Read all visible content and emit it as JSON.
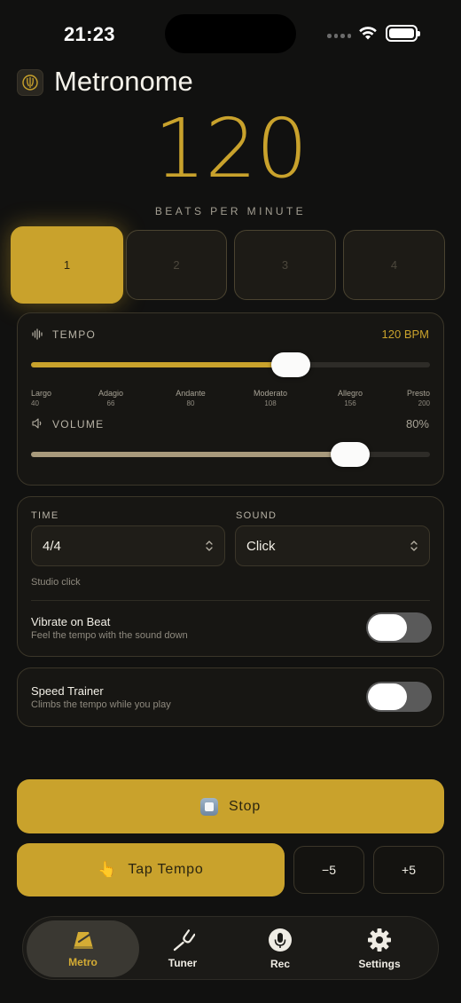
{
  "status": {
    "time": "21:23"
  },
  "header": {
    "title": "Metronome",
    "icon": "metronome-icon"
  },
  "tempo_display": {
    "bpm": "120",
    "caption": "BEATS PER MINUTE"
  },
  "beats": [
    {
      "label": "1",
      "active": true
    },
    {
      "label": "2",
      "active": false
    },
    {
      "label": "3",
      "active": false
    },
    {
      "label": "4",
      "active": false
    }
  ],
  "tempo_card": {
    "label": "TEMPO",
    "value_text": "120 BPM",
    "value": 120,
    "min": 40,
    "max": 200,
    "markers": [
      {
        "name": "Largo",
        "value": "40"
      },
      {
        "name": "Adagio",
        "value": "66"
      },
      {
        "name": "Andante",
        "value": "80"
      },
      {
        "name": "Moderato",
        "value": "108"
      },
      {
        "name": "Allegro",
        "value": "156"
      },
      {
        "name": "Presto",
        "value": "200"
      }
    ],
    "volume_label": "VOLUME",
    "volume_text": "80%",
    "volume": 0.8
  },
  "settings_card": {
    "time_label": "TIME",
    "time_value": "4/4",
    "sound_label": "SOUND",
    "sound_value": "Click",
    "sound_desc": "Studio click",
    "vibrate_title": "Vibrate on Beat",
    "vibrate_desc": "Feel the tempo with the sound down",
    "vibrate_on": false
  },
  "trainer_card": {
    "title": "Speed Trainer",
    "desc": "Climbs the tempo while you play",
    "on": false
  },
  "actions": {
    "stop_label": "Stop",
    "tap_label": "Tap Tempo",
    "minus_label": "−5",
    "plus_label": "+5"
  },
  "tabbar": [
    {
      "label": "Metro",
      "icon": "metronome-icon",
      "active": true
    },
    {
      "label": "Tuner",
      "icon": "tuning-fork-icon",
      "active": false
    },
    {
      "label": "Rec",
      "icon": "microphone-icon",
      "active": false
    },
    {
      "label": "Settings",
      "icon": "gear-icon",
      "active": false
    }
  ],
  "colors": {
    "accent": "#c9a22c",
    "background": "#111110",
    "card": "#171613"
  }
}
